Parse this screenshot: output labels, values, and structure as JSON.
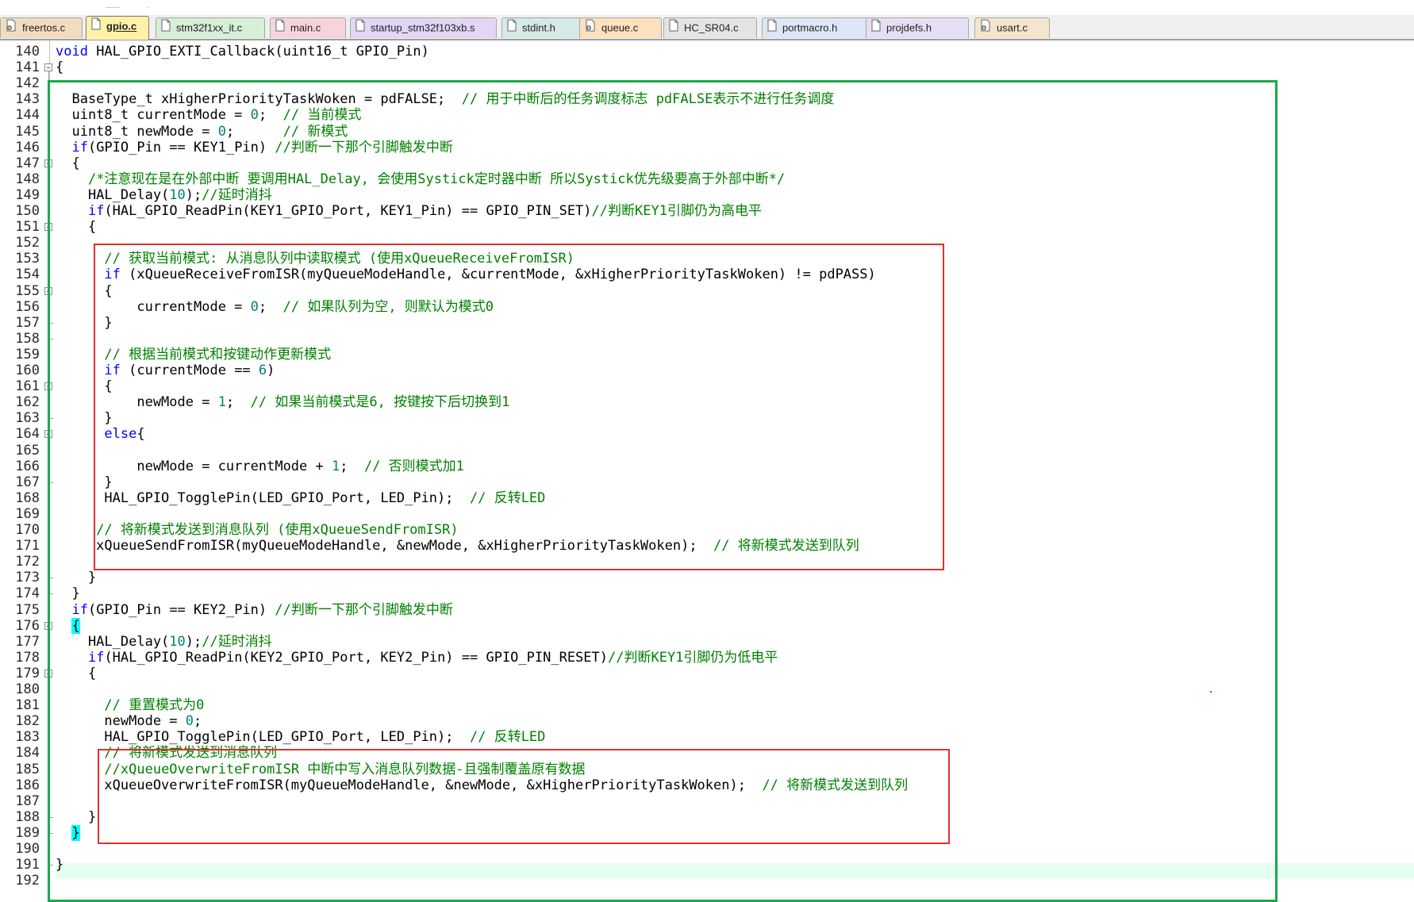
{
  "tabs": [
    {
      "label": "freertos.c",
      "icon": "c-file-gear-icon",
      "color": "#f2dcc0",
      "active": false
    },
    {
      "label": "gpio.c",
      "icon": "document-icon",
      "color": "#fff2a8",
      "active": true
    },
    {
      "label": "stm32f1xx_it.c",
      "icon": "document-icon",
      "color": "#d7eed7",
      "active": false
    },
    {
      "label": "main.c",
      "icon": "document-icon",
      "color": "#f7d4dc",
      "active": false
    },
    {
      "label": "startup_stm32f103xb.s",
      "icon": "document-icon",
      "color": "#e2d6f4",
      "active": false
    },
    {
      "label": "stdint.h",
      "icon": "document-icon",
      "color": "#d6e8e8",
      "active": false
    },
    {
      "label": "queue.c",
      "icon": "c-file-gear-icon",
      "color": "#fde0bc",
      "active": false
    },
    {
      "label": "HC_SR04.c",
      "icon": "document-icon",
      "color": "#e4e4e4",
      "active": false
    },
    {
      "label": "portmacro.h",
      "icon": "document-icon",
      "color": "#dde6f6",
      "active": false
    },
    {
      "label": "projdefs.h",
      "icon": "document-icon",
      "color": "#e6dff4",
      "active": false
    },
    {
      "label": "usart.c",
      "icon": "c-file-gear-icon",
      "color": "#f3e6cc",
      "active": false
    }
  ],
  "editor": {
    "line_numbers": [
      "140",
      "141",
      "142",
      "143",
      "144",
      "145",
      "146",
      "147",
      "148",
      "149",
      "150",
      "151",
      "152",
      "153",
      "154",
      "155",
      "156",
      "157",
      "158",
      "159",
      "160",
      "161",
      "162",
      "163",
      "164",
      "165",
      "166",
      "167",
      "168",
      "169",
      "170",
      "171",
      "172",
      "173",
      "174",
      "175",
      "176",
      "177",
      "178",
      "179",
      "180",
      "181",
      "182",
      "183",
      "184",
      "185",
      "186",
      "187",
      "188",
      "189",
      "190",
      "191",
      "192"
    ],
    "lines": [
      {
        "tokens": [
          {
            "t": "void",
            "c": "kw"
          },
          {
            "t": " HAL_GPIO_EXTI_Callback(uint16_t GPIO_Pin)"
          }
        ]
      },
      {
        "tokens": [
          {
            "t": "{"
          }
        ]
      },
      {
        "tokens": []
      },
      {
        "tokens": [
          {
            "t": "  BaseType_t xHigherPriorityTaskWoken = pdFALSE;  "
          },
          {
            "t": "// 用于中断后的任务调度标志 pdFALSE表示不进行任务调度",
            "c": "cm"
          }
        ]
      },
      {
        "tokens": [
          {
            "t": "  uint8_t currentMode = "
          },
          {
            "t": "0",
            "c": "num"
          },
          {
            "t": ";  "
          },
          {
            "t": "// 当前模式",
            "c": "cm"
          }
        ]
      },
      {
        "tokens": [
          {
            "t": "  uint8_t newMode = "
          },
          {
            "t": "0",
            "c": "num"
          },
          {
            "t": ";      "
          },
          {
            "t": "// 新模式",
            "c": "cm"
          }
        ]
      },
      {
        "tokens": [
          {
            "t": "  "
          },
          {
            "t": "if",
            "c": "kw"
          },
          {
            "t": "(GPIO_Pin == KEY1_Pin) "
          },
          {
            "t": "//判断一下那个引脚触发中断",
            "c": "cm"
          }
        ]
      },
      {
        "tokens": [
          {
            "t": "  {"
          }
        ]
      },
      {
        "tokens": [
          {
            "t": "    "
          },
          {
            "t": "/*注意现在是在外部中断 要调用HAL_Delay, 会使用Systick定时器中断 所以Systick优先级要高于外部中断*/",
            "c": "cm"
          }
        ]
      },
      {
        "tokens": [
          {
            "t": "    HAL_Delay("
          },
          {
            "t": "10",
            "c": "num"
          },
          {
            "t": ");"
          },
          {
            "t": "//延时消抖",
            "c": "cm"
          }
        ]
      },
      {
        "tokens": [
          {
            "t": "    "
          },
          {
            "t": "if",
            "c": "kw"
          },
          {
            "t": "(HAL_GPIO_ReadPin(KEY1_GPIO_Port, KEY1_Pin) == GPIO_PIN_SET)"
          },
          {
            "t": "//判断KEY1引脚仍为高电平",
            "c": "cm"
          }
        ]
      },
      {
        "tokens": [
          {
            "t": "    {"
          }
        ]
      },
      {
        "tokens": []
      },
      {
        "tokens": [
          {
            "t": "      "
          },
          {
            "t": "// 获取当前模式: 从消息队列中读取模式 (使用xQueueReceiveFromISR)",
            "c": "cm"
          }
        ]
      },
      {
        "tokens": [
          {
            "t": "      "
          },
          {
            "t": "if",
            "c": "kw"
          },
          {
            "t": " (xQueueReceiveFromISR(myQueueModeHandle, &currentMode, &xHigherPriorityTaskWoken) != pdPASS)"
          }
        ]
      },
      {
        "tokens": [
          {
            "t": "      {"
          }
        ]
      },
      {
        "tokens": [
          {
            "t": "          currentMode = "
          },
          {
            "t": "0",
            "c": "num"
          },
          {
            "t": ";  "
          },
          {
            "t": "// 如果队列为空, 则默认为模式0",
            "c": "cm"
          }
        ]
      },
      {
        "tokens": [
          {
            "t": "      }"
          }
        ]
      },
      {
        "tokens": []
      },
      {
        "tokens": [
          {
            "t": "      "
          },
          {
            "t": "// 根据当前模式和按键动作更新模式",
            "c": "cm"
          }
        ]
      },
      {
        "tokens": [
          {
            "t": "      "
          },
          {
            "t": "if",
            "c": "kw"
          },
          {
            "t": " (currentMode == "
          },
          {
            "t": "6",
            "c": "num"
          },
          {
            "t": ")"
          }
        ]
      },
      {
        "tokens": [
          {
            "t": "      {"
          }
        ]
      },
      {
        "tokens": [
          {
            "t": "          newMode = "
          },
          {
            "t": "1",
            "c": "num"
          },
          {
            "t": ";  "
          },
          {
            "t": "// 如果当前模式是6, 按键按下后切换到1",
            "c": "cm"
          }
        ]
      },
      {
        "tokens": [
          {
            "t": "      }"
          }
        ]
      },
      {
        "tokens": [
          {
            "t": "      "
          },
          {
            "t": "else",
            "c": "kw"
          },
          {
            "t": "{"
          }
        ]
      },
      {
        "tokens": []
      },
      {
        "tokens": [
          {
            "t": "          newMode = currentMode + "
          },
          {
            "t": "1",
            "c": "num"
          },
          {
            "t": ";  "
          },
          {
            "t": "// 否则模式加1",
            "c": "cm"
          }
        ]
      },
      {
        "tokens": [
          {
            "t": "      }"
          }
        ]
      },
      {
        "tokens": [
          {
            "t": "      HAL_GPIO_TogglePin(LED_GPIO_Port, LED_Pin);  "
          },
          {
            "t": "// 反转LED",
            "c": "cm"
          }
        ]
      },
      {
        "tokens": []
      },
      {
        "tokens": [
          {
            "t": "     "
          },
          {
            "t": "// 将新模式发送到消息队列 (使用xQueueSendFromISR)",
            "c": "cm"
          }
        ]
      },
      {
        "tokens": [
          {
            "t": "     xQueueSendFromISR(myQueueModeHandle, &newMode, &xHigherPriorityTaskWoken);  "
          },
          {
            "t": "// 将新模式发送到队列",
            "c": "cm"
          }
        ]
      },
      {
        "tokens": []
      },
      {
        "tokens": [
          {
            "t": "    }"
          }
        ]
      },
      {
        "tokens": [
          {
            "t": "  }"
          }
        ]
      },
      {
        "tokens": [
          {
            "t": "  "
          },
          {
            "t": "if",
            "c": "kw"
          },
          {
            "t": "(GPIO_Pin == KEY2_Pin) "
          },
          {
            "t": "//判断一下那个引脚触发中断",
            "c": "cm"
          }
        ]
      },
      {
        "tokens": [
          {
            "t": "  "
          },
          {
            "t": "{",
            "c": "bh"
          }
        ]
      },
      {
        "tokens": [
          {
            "t": "    HAL_Delay("
          },
          {
            "t": "10",
            "c": "num"
          },
          {
            "t": ");"
          },
          {
            "t": "//延时消抖",
            "c": "cm"
          }
        ]
      },
      {
        "tokens": [
          {
            "t": "    "
          },
          {
            "t": "if",
            "c": "kw"
          },
          {
            "t": "(HAL_GPIO_ReadPin(KEY2_GPIO_Port, KEY2_Pin) == GPIO_PIN_RESET)"
          },
          {
            "t": "//判断KEY1引脚仍为低电平",
            "c": "cm"
          }
        ]
      },
      {
        "tokens": [
          {
            "t": "    {"
          }
        ]
      },
      {
        "tokens": []
      },
      {
        "tokens": [
          {
            "t": "      "
          },
          {
            "t": "// 重置模式为0",
            "c": "cm"
          }
        ]
      },
      {
        "tokens": [
          {
            "t": "      newMode = "
          },
          {
            "t": "0",
            "c": "num"
          },
          {
            "t": ";"
          }
        ]
      },
      {
        "tokens": [
          {
            "t": "      HAL_GPIO_TogglePin(LED_GPIO_Port, LED_Pin);  "
          },
          {
            "t": "// 反转LED",
            "c": "cm"
          }
        ]
      },
      {
        "tokens": [
          {
            "t": "      "
          },
          {
            "t": "// 将新模式发送到消息队列",
            "c": "cm"
          }
        ]
      },
      {
        "tokens": [
          {
            "t": "      "
          },
          {
            "t": "//xQueueOverwriteFromISR 中断中写入消息队列数据-且强制覆盖原有数据",
            "c": "cm"
          }
        ]
      },
      {
        "tokens": [
          {
            "t": "      xQueueOverwriteFromISR(myQueueModeHandle, &newMode, &xHigherPriorityTaskWoken);  "
          },
          {
            "t": "// 将新模式发送到队列",
            "c": "cm"
          }
        ]
      },
      {
        "tokens": []
      },
      {
        "tokens": [
          {
            "t": "    }"
          }
        ]
      },
      {
        "tokens": [
          {
            "t": "  "
          },
          {
            "t": "}",
            "c": "bh"
          }
        ]
      },
      {
        "tokens": []
      },
      {
        "tokens": [
          {
            "t": "}"
          }
        ]
      },
      {
        "tokens": []
      }
    ]
  },
  "annotation_colors": {
    "outer_box": "#1aaa4a",
    "inner_boxes": "#e03030"
  }
}
